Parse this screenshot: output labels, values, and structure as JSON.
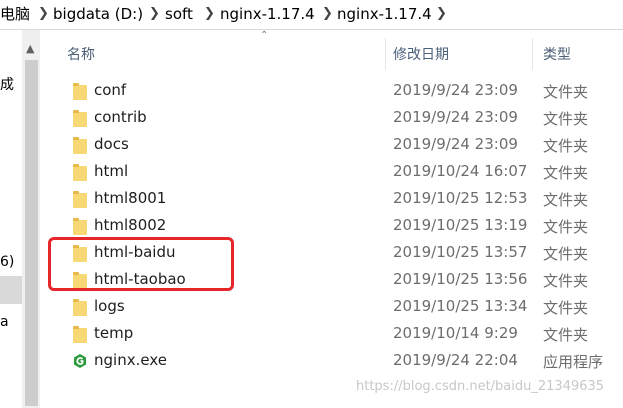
{
  "breadcrumb": {
    "items": [
      "电脑",
      "bigdata (D:)",
      "soft",
      "nginx-1.17.4",
      "nginx-1.17.4"
    ],
    "separator_icon": "chevron-right-icon"
  },
  "nav": {
    "items": [
      "成",
      "6)",
      "a"
    ]
  },
  "columns": {
    "name": "名称",
    "modified": "修改日期",
    "type": "类型",
    "sort_icon": "sort-up-icon"
  },
  "files": [
    {
      "name": "conf",
      "modified": "2019/9/24 23:09",
      "type": "文件夹",
      "icon": "folder-icon"
    },
    {
      "name": "contrib",
      "modified": "2019/9/24 23:09",
      "type": "文件夹",
      "icon": "folder-icon"
    },
    {
      "name": "docs",
      "modified": "2019/9/24 23:09",
      "type": "文件夹",
      "icon": "folder-icon"
    },
    {
      "name": "html",
      "modified": "2019/10/24 16:07",
      "type": "文件夹",
      "icon": "folder-icon"
    },
    {
      "name": "html8001",
      "modified": "2019/10/25 12:53",
      "type": "文件夹",
      "icon": "folder-icon"
    },
    {
      "name": "html8002",
      "modified": "2019/10/25 13:19",
      "type": "文件夹",
      "icon": "folder-icon"
    },
    {
      "name": "html-baidu",
      "modified": "2019/10/25 13:57",
      "type": "文件夹",
      "icon": "folder-icon"
    },
    {
      "name": "html-taobao",
      "modified": "2019/10/25 13:56",
      "type": "文件夹",
      "icon": "folder-icon"
    },
    {
      "name": "logs",
      "modified": "2019/10/25 13:34",
      "type": "文件夹",
      "icon": "folder-icon"
    },
    {
      "name": "temp",
      "modified": "2019/10/14 9:29",
      "type": "文件夹",
      "icon": "folder-icon"
    },
    {
      "name": "nginx.exe",
      "modified": "2019/9/24 22:04",
      "type": "应用程序",
      "icon": "nginx-exe-icon"
    }
  ],
  "watermark": "https://blog.csdn.net/baidu_21349635",
  "colors": {
    "annotation": "#e8262a",
    "folder": "#f8d775",
    "header_text": "#4c607a",
    "nginx_green": "#2a9a3c"
  }
}
